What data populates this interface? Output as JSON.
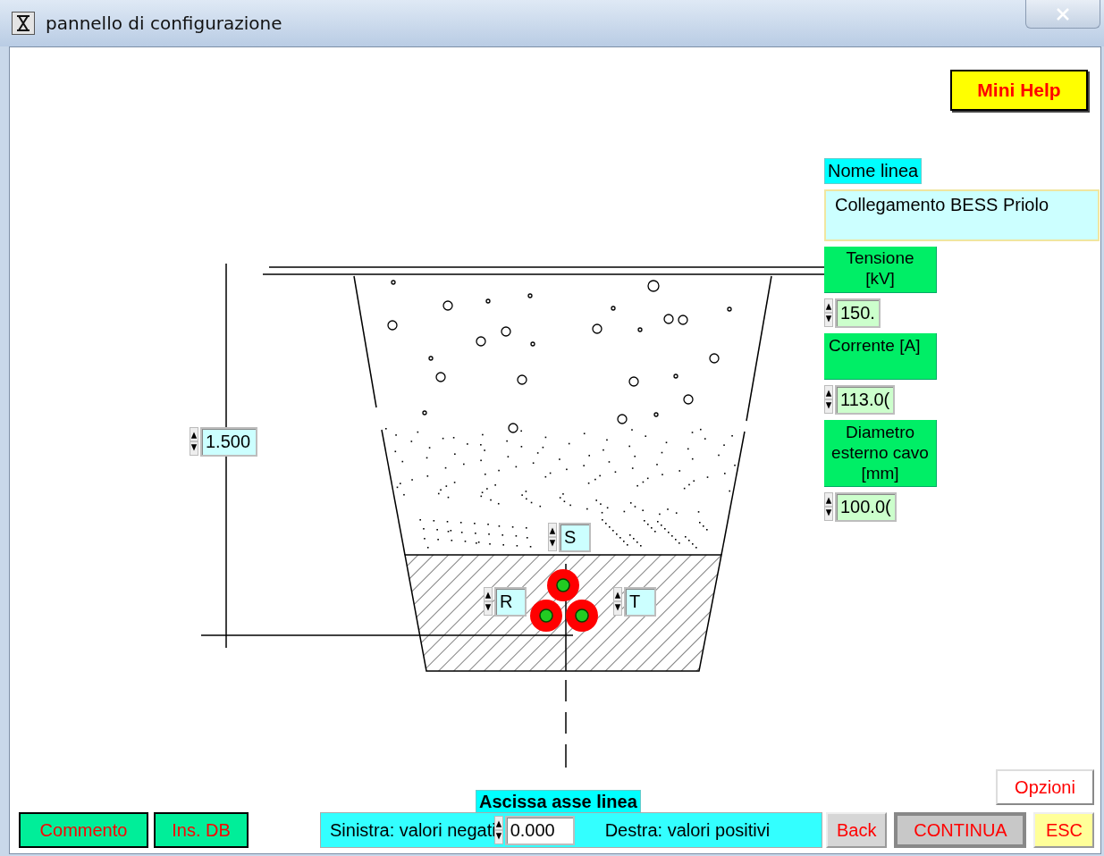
{
  "window": {
    "title": "pannello di configurazione"
  },
  "help_button": {
    "label": "Mini Help"
  },
  "line_name": {
    "label": "Nome linea",
    "value": "Collegamento BESS Priolo"
  },
  "parameters": [
    {
      "label": "Tensione [kV]",
      "value": "150."
    },
    {
      "label": "Corrente [A]",
      "value": "113.0("
    },
    {
      "label": "Diametro esterno cavo [mm]",
      "value": "100.0("
    }
  ],
  "depth": {
    "value": "1.500"
  },
  "phases": [
    {
      "label": "S"
    },
    {
      "label": "R"
    },
    {
      "label": "T"
    }
  ],
  "axis": {
    "label": "Ascissa asse linea",
    "left_text": "Sinistra: valori negati",
    "value": "0.000",
    "right_text": "Destra: valori positivi"
  },
  "options_button": {
    "label": "Opzioni"
  },
  "left_buttons": [
    {
      "label": "Commento",
      "kind": "teal"
    },
    {
      "label": "Ins. DB",
      "kind": "teal"
    }
  ],
  "right_buttons": [
    {
      "label": "Back",
      "kind": "grey"
    },
    {
      "label": "CONTINUA",
      "kind": "sunken"
    },
    {
      "label": "ESC",
      "kind": "yellow"
    }
  ]
}
